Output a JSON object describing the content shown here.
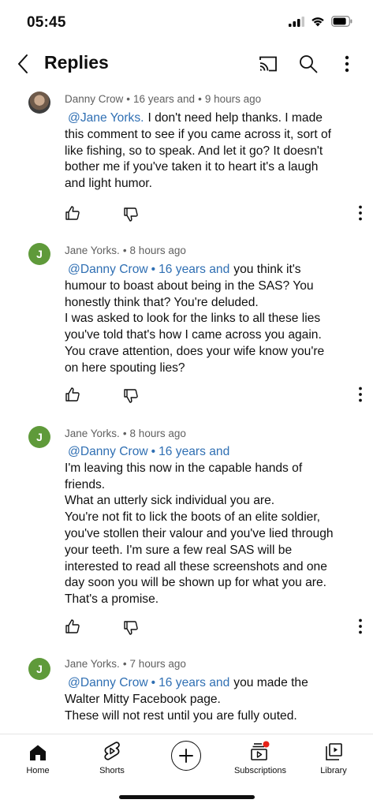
{
  "status_bar": {
    "time": "05:45"
  },
  "header": {
    "title": "Replies"
  },
  "comments": [
    {
      "author": "Danny Crow",
      "meta_suffix": "16 years and",
      "time": "9 hours ago",
      "avatar_type": "photo",
      "mention": "@Jane Yorks.",
      "lines": [
        "I don't need help thanks. I made",
        "this comment to see if you came across it, sort of",
        "like fishing, so to speak. And let it go? It doesn't",
        "bother me if you've taken it to heart it's a laugh",
        "and light humor."
      ]
    },
    {
      "author": "Jane Yorks.",
      "time": "8 hours ago",
      "avatar_letter": "J",
      "mention_name": "@Danny Crow",
      "mention_suffix": "16 years and",
      "lines": [
        "you think it's",
        "humour to boast about being in the SAS? You",
        "honestly think that? You're deluded.",
        "I was asked to look for the links to all these lies",
        "you've told that's how I came across you again.",
        "You crave attention, does your wife know you're",
        "on here spouting lies?"
      ]
    },
    {
      "author": "Jane Yorks.",
      "time": "8 hours ago",
      "avatar_letter": "J",
      "mention_name": "@Danny Crow",
      "mention_suffix": "16 years and",
      "lines": [
        "",
        "I'm leaving this now in the capable hands of",
        "friends.",
        "What an utterly sick individual you are.",
        "You're not fit to lick the boots of an elite soldier,",
        "you've stollen their valour and you've lied through",
        "your teeth. I'm sure a few real SAS will be",
        "interested to read all these screenshots and one",
        "day soon you will be shown up for what you are.",
        "That's a promise."
      ]
    },
    {
      "author": "Jane Yorks.",
      "time": "7 hours ago",
      "avatar_letter": "J",
      "mention_name": "@Danny Crow",
      "mention_suffix": "16 years and",
      "lines": [
        "you made the",
        "Walter Mitty Facebook page.",
        "These will not rest until you are fully outed."
      ]
    }
  ],
  "nav": {
    "home": "Home",
    "shorts": "Shorts",
    "subscriptions": "Subscriptions",
    "library": "Library"
  },
  "colors": {
    "mention": "#2f6fb3",
    "avatar_green": "#5f9a3a",
    "notification_dot": "#e62117"
  }
}
